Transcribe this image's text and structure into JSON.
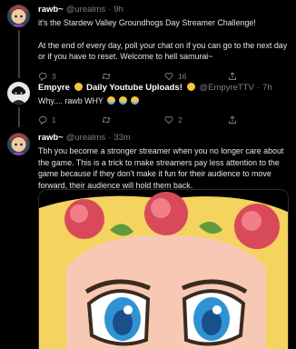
{
  "tweets": [
    {
      "name": "rawb~",
      "handle": "@urealms",
      "sep": "·",
      "time": "9h",
      "paragraphs": [
        "it's the Stardew Valley Groundhogs Day Streamer Challenge!",
        "At the end of every day, poll your chat on if you can go to the next day or if you have to reset. Welcome to hell samurai~"
      ],
      "reply_count": "3",
      "retweet_count": "",
      "like_count": "16"
    },
    {
      "name": "Empyre",
      "name_suffix": "Daily Youtube Uploads!",
      "handle": "@EmpyreTTV",
      "sep": "·",
      "time": "7h",
      "text": "Why.... rawb WHY",
      "reply_count": "1",
      "retweet_count": "",
      "like_count": "2"
    },
    {
      "name": "rawb~",
      "handle": "@urealms",
      "sep": "·",
      "time": "33m",
      "paragraphs": [
        "Tbh you become a stronger streamer when you no longer care about the game. This is a trick to make streamers pay less attention to the game because if they don't make it fun for their audience to move forward, their audience will hold them back."
      ]
    }
  ],
  "icons": {
    "reply": "reply-icon",
    "retweet": "retweet-icon",
    "like": "heart-icon",
    "share": "share-icon"
  },
  "colors": {
    "background": "#000000",
    "secondary_text": "#7b8189",
    "primary_text": "#e2e4e6"
  }
}
